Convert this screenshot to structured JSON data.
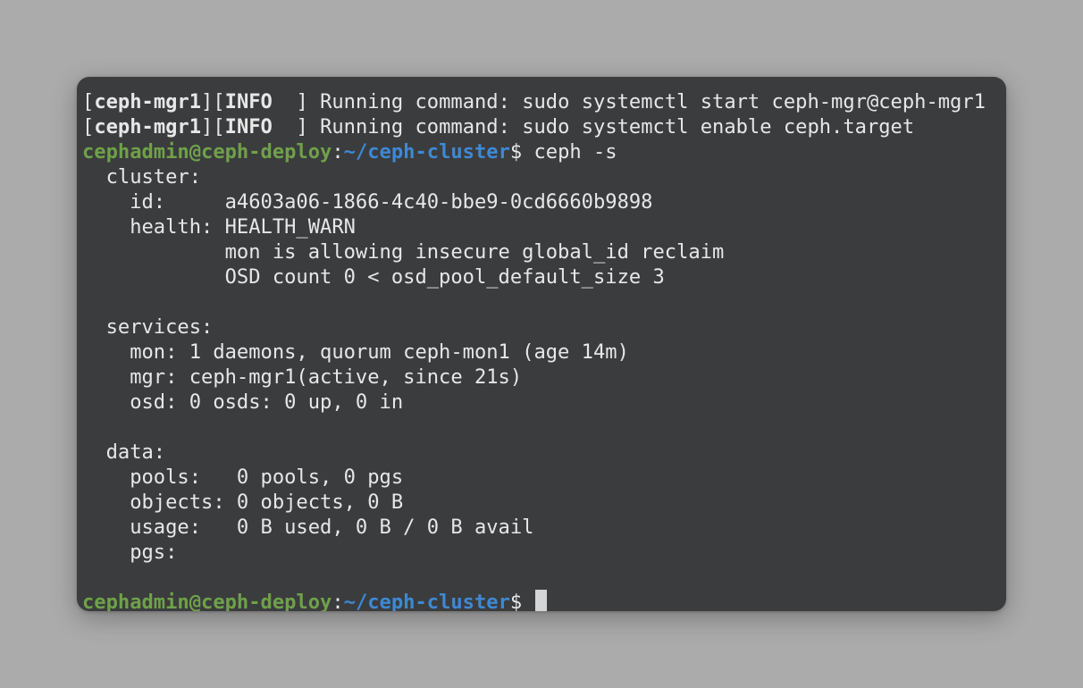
{
  "terminal": {
    "log_lines": [
      {
        "open": "[",
        "tag": "ceph-mgr1",
        "sep": "][",
        "level": "INFO",
        "close": "  ] ",
        "message": "Running command: sudo systemctl start ceph-mgr@ceph-mgr1"
      },
      {
        "open": "[",
        "tag": "ceph-mgr1",
        "sep": "][",
        "level": "INFO",
        "close": "  ] ",
        "message": "Running command: sudo systemctl enable ceph.target"
      }
    ],
    "prompt": {
      "user_host": "cephadmin@ceph-deploy",
      "colon": ":",
      "path": "~/ceph-cluster",
      "symbol": "$ "
    },
    "command": "ceph -s",
    "output": [
      "  cluster:",
      "    id:     a4603a06-1866-4c40-bbe9-0cd6660b9898",
      "    health: HEALTH_WARN",
      "            mon is allowing insecure global_id reclaim",
      "            OSD count 0 < osd_pool_default_size 3",
      "",
      "  services:",
      "    mon: 1 daemons, quorum ceph-mon1 (age 14m)",
      "    mgr: ceph-mgr1(active, since 21s)",
      "    osd: 0 osds: 0 up, 0 in",
      "",
      "  data:",
      "    pools:   0 pools, 0 pgs",
      "    objects: 0 objects, 0 B",
      "    usage:   0 B used, 0 B / 0 B avail",
      "    pgs:",
      ""
    ]
  },
  "colors": {
    "page_background": "#ababab",
    "terminal_background": "#3b3c3e",
    "text": "#e7e7e7",
    "prompt_user_host": "#6fa149",
    "prompt_path": "#3e89d3",
    "cursor": "#d4d4d4"
  }
}
